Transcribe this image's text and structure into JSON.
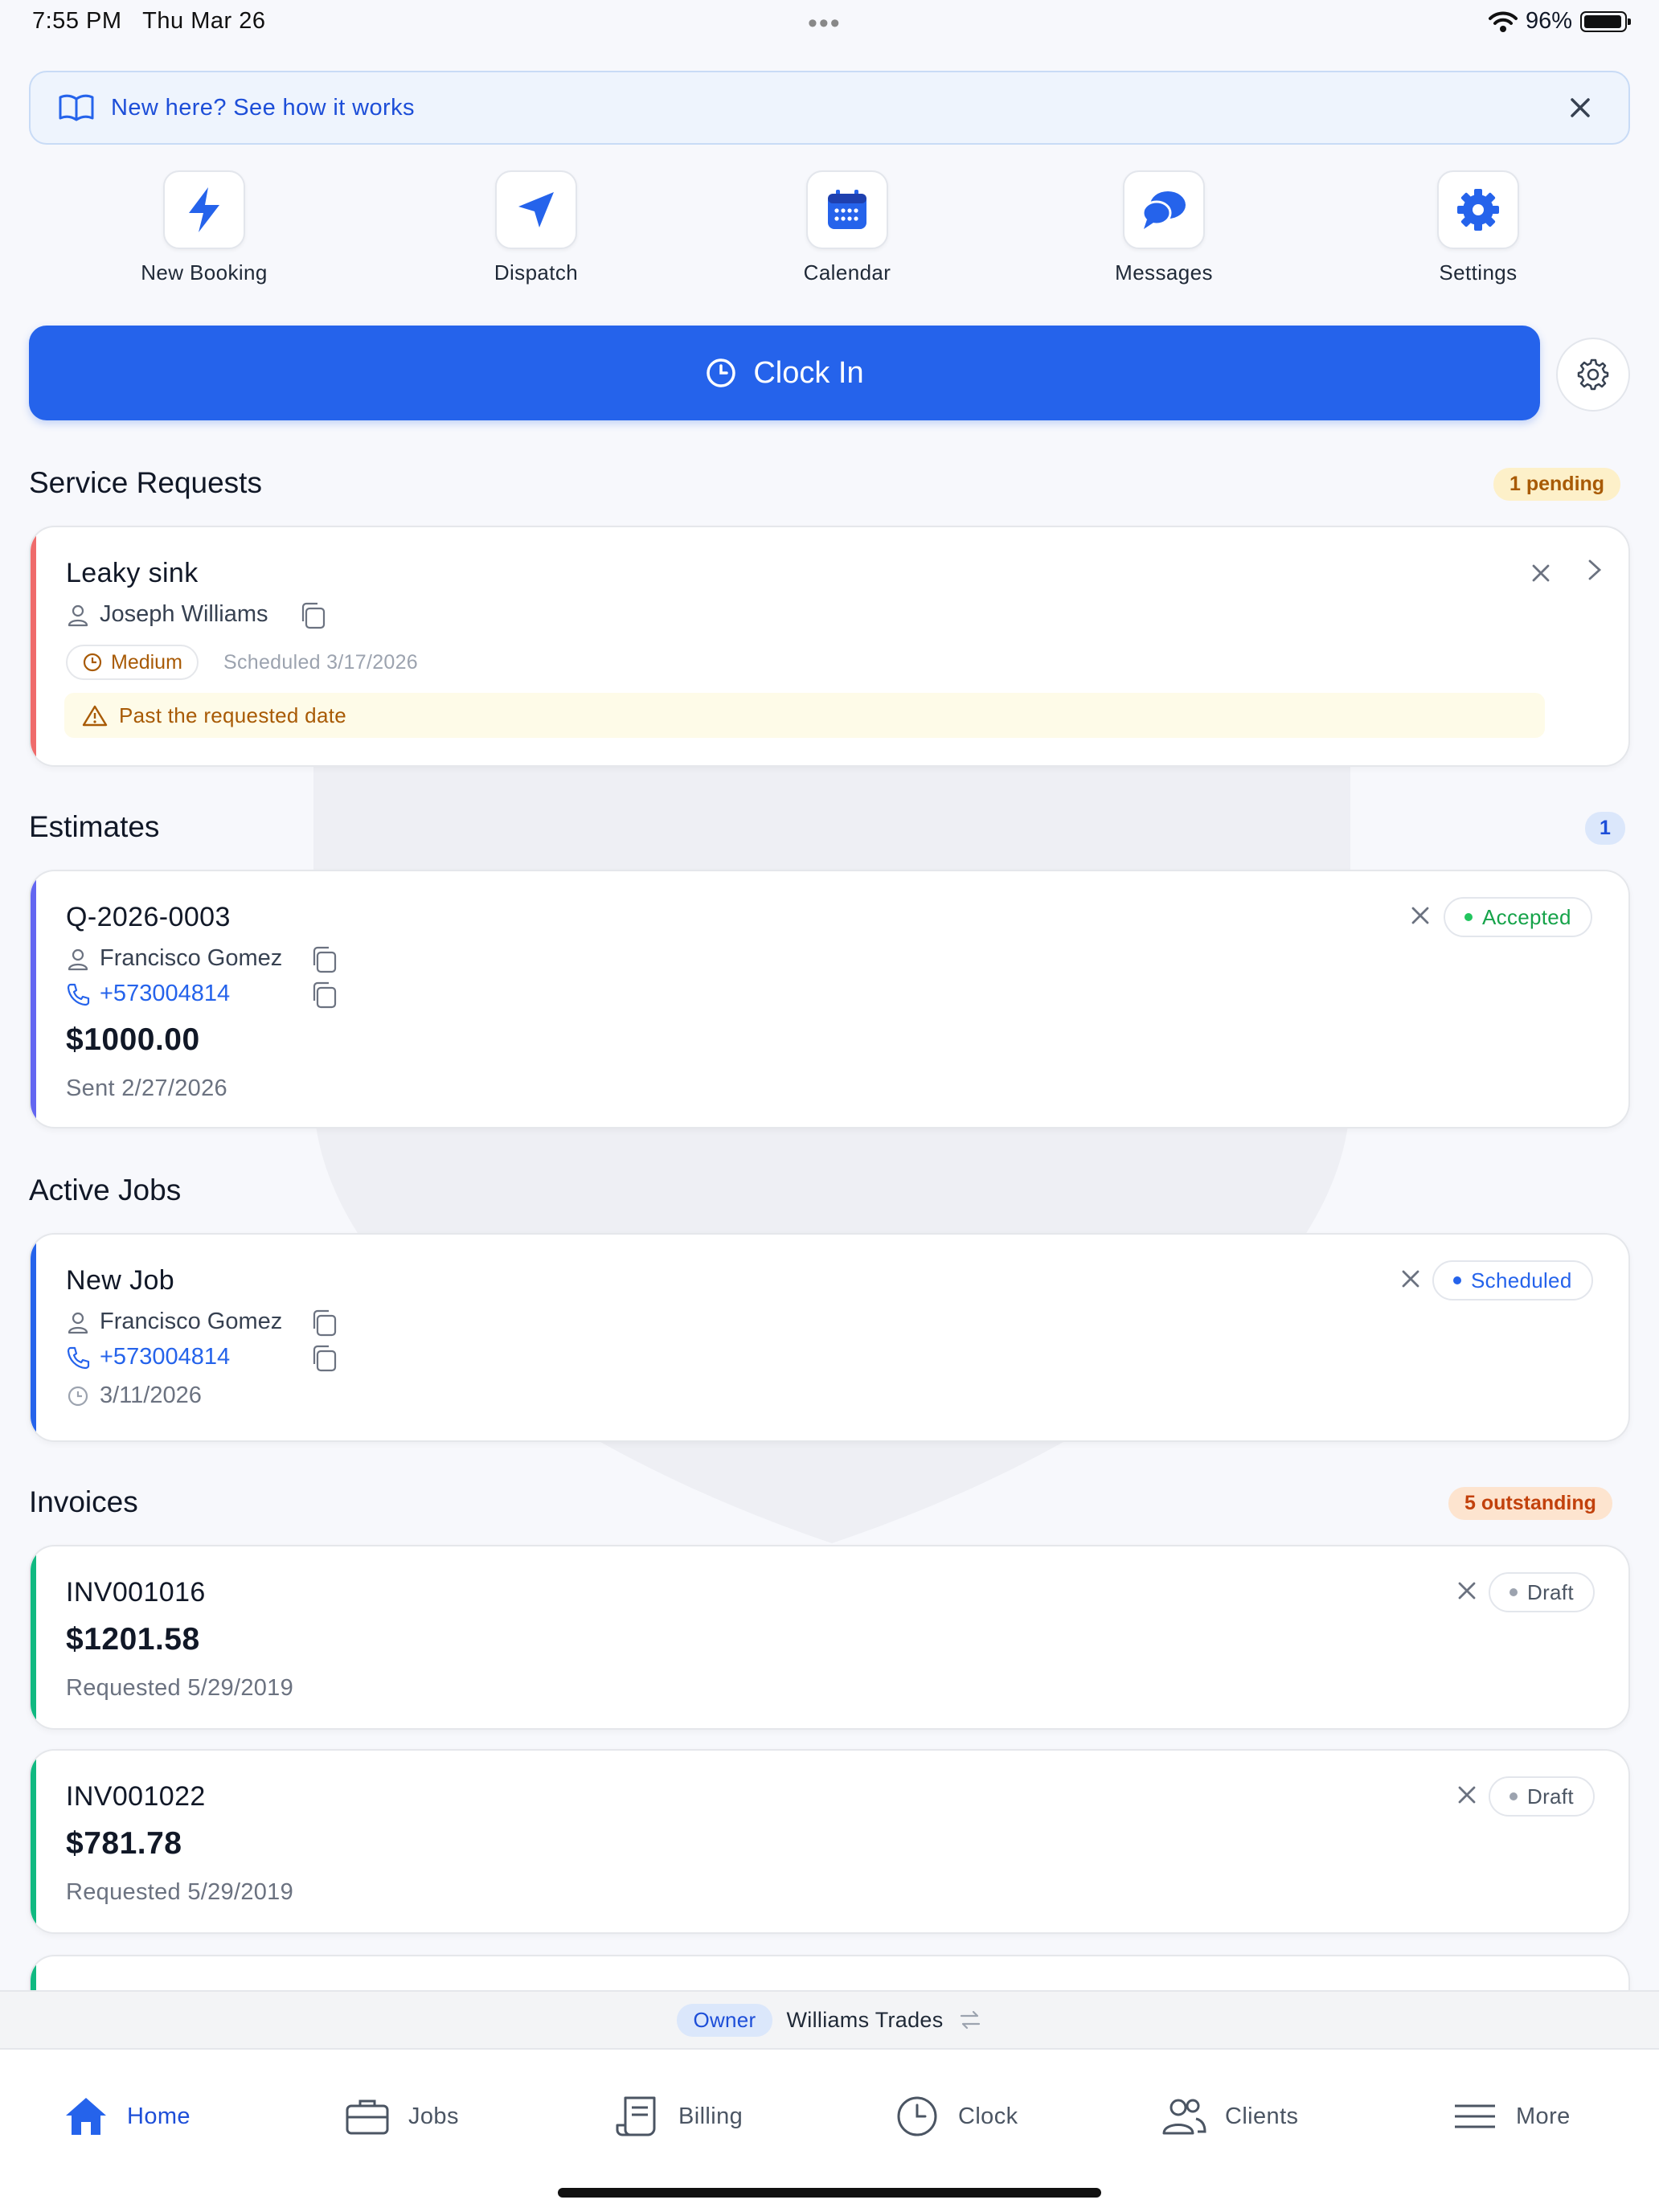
{
  "status_bar": {
    "time": "7:55 PM",
    "date": "Thu Mar 26",
    "battery": "96%",
    "battery_level": 0.96
  },
  "banner": {
    "text": "New here? See how it works",
    "icon": "book-icon"
  },
  "quick_actions": [
    {
      "label": "New Booking",
      "icon": "bolt-icon"
    },
    {
      "label": "Dispatch",
      "icon": "navigation-arrow-icon"
    },
    {
      "label": "Calendar",
      "icon": "calendar-icon"
    },
    {
      "label": "Messages",
      "icon": "chat-bubbles-icon"
    },
    {
      "label": "Settings",
      "icon": "gear-icon"
    }
  ],
  "clock_in": {
    "label": "Clock In"
  },
  "service_requests": {
    "title": "Service Requests",
    "badge": "1 pending",
    "items": [
      {
        "title": "Leaky sink",
        "client": "Joseph Williams",
        "priority": "Medium",
        "scheduled": "Scheduled 3/17/2026",
        "warning": "Past the requested date",
        "accent": "#ef6b6b"
      }
    ]
  },
  "estimates": {
    "title": "Estimates",
    "badge": "1",
    "items": [
      {
        "id": "Q-2026-0003",
        "client": "Francisco Gomez",
        "phone": "+573004814",
        "amount": "$1000.00",
        "sent": "Sent 2/27/2026",
        "status": "Accepted",
        "status_color": "#16a34a",
        "accent": "#6366f1"
      }
    ]
  },
  "active_jobs": {
    "title": "Active Jobs",
    "items": [
      {
        "title": "New Job",
        "client": "Francisco Gomez",
        "phone": "+573004814",
        "date": "3/11/2026",
        "status": "Scheduled",
        "status_color": "#2563eb",
        "accent": "#2563eb"
      }
    ]
  },
  "invoices": {
    "title": "Invoices",
    "badge": "5 outstanding",
    "items": [
      {
        "id": "INV001016",
        "amount": "$1201.58",
        "requested": "Requested 5/29/2019",
        "status": "Draft",
        "accent": "#10b981"
      },
      {
        "id": "INV001022",
        "amount": "$781.78",
        "requested": "Requested 5/29/2019",
        "status": "Draft",
        "accent": "#10b981"
      }
    ]
  },
  "account": {
    "role": "Owner",
    "business": "Williams Trades"
  },
  "tabs": [
    {
      "label": "Home",
      "icon": "home-icon",
      "active": true
    },
    {
      "label": "Jobs",
      "icon": "briefcase-icon"
    },
    {
      "label": "Billing",
      "icon": "receipt-icon"
    },
    {
      "label": "Clock",
      "icon": "clock-icon"
    },
    {
      "label": "Clients",
      "icon": "users-icon"
    },
    {
      "label": "More",
      "icon": "menu-icon"
    }
  ]
}
